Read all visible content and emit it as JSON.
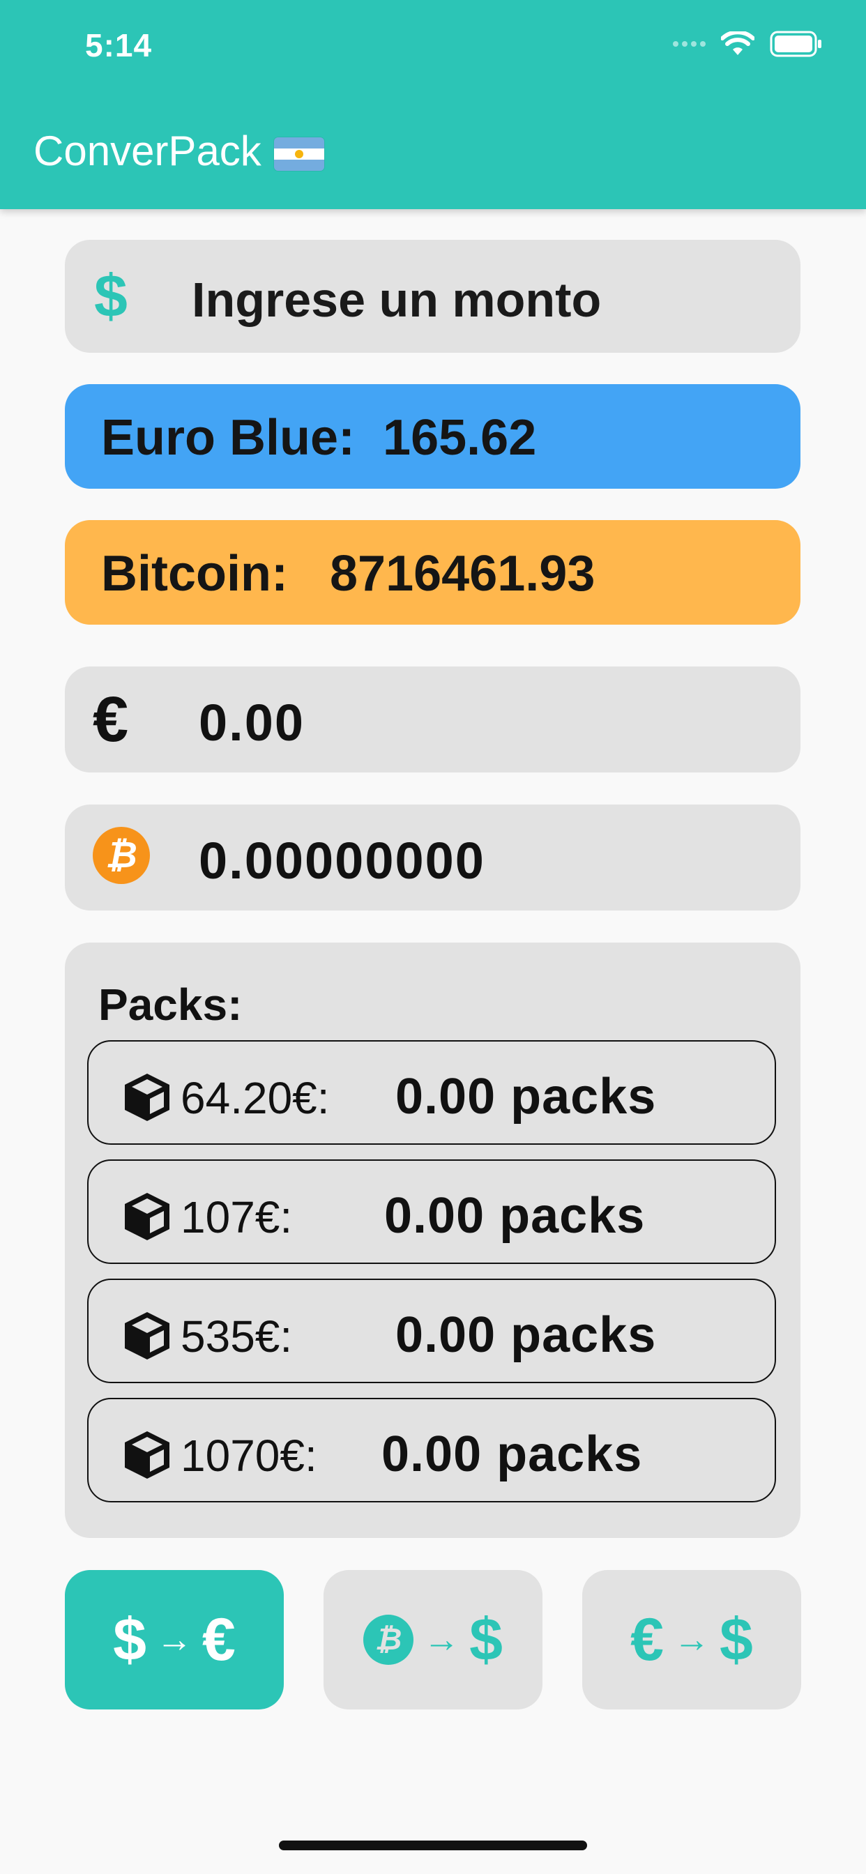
{
  "status_bar": {
    "time": "5:14"
  },
  "app_bar": {
    "title": "ConverPack"
  },
  "input": {
    "placeholder": "Ingrese un monto",
    "icon": "dollar-icon"
  },
  "rates": {
    "euro_blue": {
      "label": "Euro Blue:",
      "value": "165.62",
      "color": "#43a4f5"
    },
    "bitcoin": {
      "label": "Bitcoin:",
      "value": "8716461.93",
      "color": "#ffb74d"
    }
  },
  "results": {
    "euro": {
      "symbol": "€",
      "value": "0.00"
    },
    "bitcoin": {
      "symbol": "₿",
      "value": "0.00000000"
    }
  },
  "packs": {
    "title": "Packs:",
    "items": [
      {
        "price": "64.20€:",
        "count": "0.00 packs"
      },
      {
        "price": "107€:",
        "count": "0.00 packs"
      },
      {
        "price": "535€:",
        "count": "0.00 packs"
      },
      {
        "price": "1070€:",
        "count": "0.00 packs"
      }
    ]
  },
  "tabs": [
    {
      "from": "$",
      "to": "€",
      "active": true
    },
    {
      "from": "₿",
      "to": "$",
      "active": false
    },
    {
      "from": "€",
      "to": "$",
      "active": false
    }
  ],
  "colors": {
    "accent": "#2cc5b6",
    "card": "#e2e2e2",
    "bitcoin_orange": "#f7931a"
  }
}
